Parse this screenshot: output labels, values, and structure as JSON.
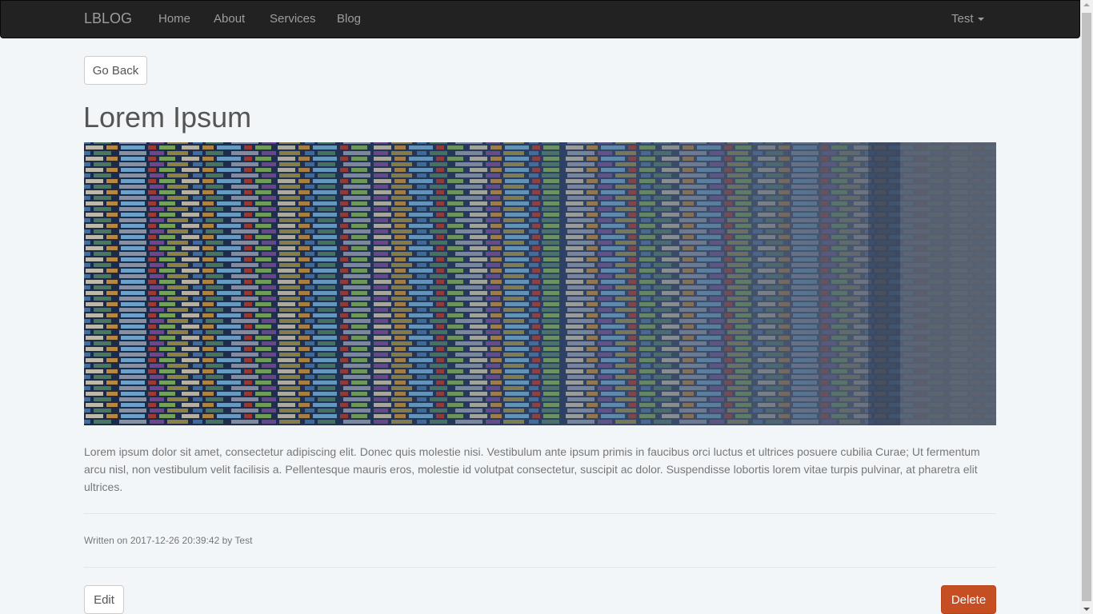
{
  "navbar": {
    "brand": "LBLOG",
    "links": [
      "Home",
      "About",
      "Services",
      "Blog"
    ],
    "user": "Test"
  },
  "post": {
    "go_back_label": "Go Back",
    "title": "Lorem Ipsum",
    "body": "Lorem ipsum dolor sit amet, consectetur adipiscing elit. Donec quis molestie nisi. Vestibulum ante ipsum primis in faucibus orci luctus et ultrices posuere cubilia Curae; Ut fermentum arcu nisl, non vestibulum velit facilisis a. Pellentesque mauris eros, molestie id volutpat consectetur, suscipit ac dolor. Suspendisse lobortis lorem vitae turpis pulvinar, at pharetra elit ultrices.",
    "meta": {
      "prefix": "Written on",
      "date": "2017-12-26 20:39:42",
      "by": "by",
      "author": "Test"
    },
    "edit_label": "Edit",
    "delete_label": "Delete"
  },
  "colors": {
    "navbar_bg": "#222222",
    "page_bg": "#f3f6f9",
    "delete_bg": "#c54e23",
    "text": "#777777"
  },
  "icons": {
    "user_menu": "caret-down-icon"
  }
}
